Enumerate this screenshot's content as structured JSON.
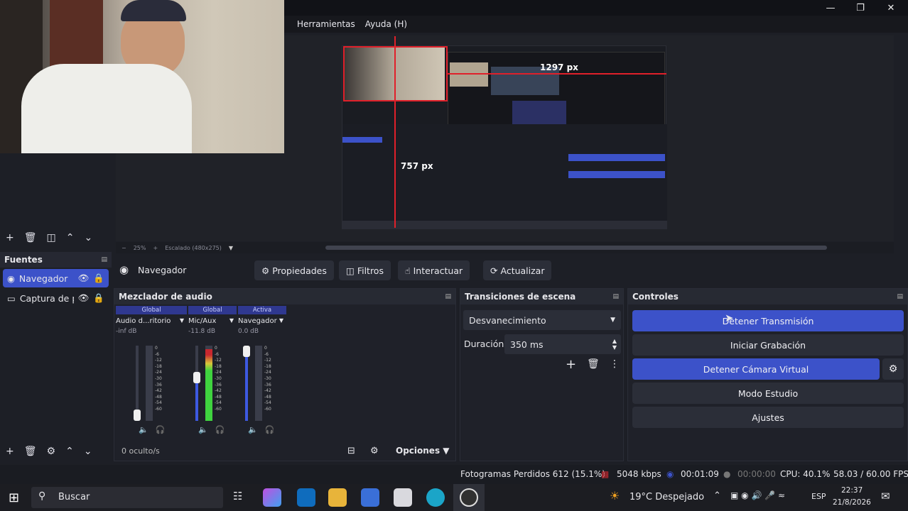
{
  "window": {
    "min_icon": "minimize-icon",
    "max_icon": "restore-icon",
    "close_icon": "close-icon"
  },
  "menu": {
    "items": [
      "Herramientas",
      "Ayuda (H)"
    ]
  },
  "preview": {
    "label_width": "1297 px",
    "label_height": "757 px",
    "zoom": "25%",
    "scaled": "Escalado (480x275)"
  },
  "sources": {
    "title": "Fuentes",
    "items": [
      {
        "label": "Navegador",
        "selected": true
      },
      {
        "label": "Captura de p",
        "selected": false
      }
    ],
    "hidden": "0 oculto/s"
  },
  "source_toolbar": {
    "selected": "Navegador",
    "buttons": [
      "Propiedades",
      "Filtros",
      "Interactuar",
      "Actualizar"
    ]
  },
  "mixer": {
    "title": "Mezclador de audio",
    "channels": [
      {
        "mode": "Global",
        "name": "Audio d...ritorio",
        "db": "-inf dB",
        "fader": 0.08,
        "level": 0.0,
        "muted": true
      },
      {
        "mode": "Global",
        "name": "Mic/Aux",
        "db": "-11.8 dB",
        "fader": 0.65,
        "level": 0.95,
        "muted": false
      },
      {
        "mode": "Activa",
        "name": "Navegador",
        "db": "0.0 dB",
        "fader": 1.0,
        "level": 0.0,
        "muted": true
      }
    ],
    "scale": [
      "0",
      "-6",
      "-12",
      "-18",
      "-24",
      "-30",
      "-36",
      "-42",
      "-48",
      "-54",
      "-60"
    ],
    "options": "Opciones"
  },
  "transitions": {
    "title": "Transiciones de escena",
    "type": "Desvanecimiento",
    "duration_label": "Duración",
    "duration": "350 ms"
  },
  "controls": {
    "title": "Controles",
    "buttons": [
      "Detener Transmisión",
      "Iniciar Grabación",
      "Detener Cámara Virtual",
      "Modo Estudio",
      "Ajustes"
    ]
  },
  "status": {
    "dropped": "Fotogramas Perdidos 612 (15.1%)",
    "bitrate": "5048 kbps",
    "stream_time": "00:01:09",
    "rec_time": "00:00:00",
    "cpu": "CPU: 40.1%",
    "fps": "58.03 / 60.00 FPS"
  },
  "taskbar": {
    "search": "Buscar",
    "weather": "19°C  Despejado",
    "lang": "ESP",
    "time": "22:37",
    "date": "21/8/2026"
  },
  "colors": {
    "accent": "#3c52c9",
    "guide": "#e0202a",
    "meter_green": "#3fd33f",
    "meter_yellow": "#d9c63a",
    "meter_red": "#c8282f"
  }
}
